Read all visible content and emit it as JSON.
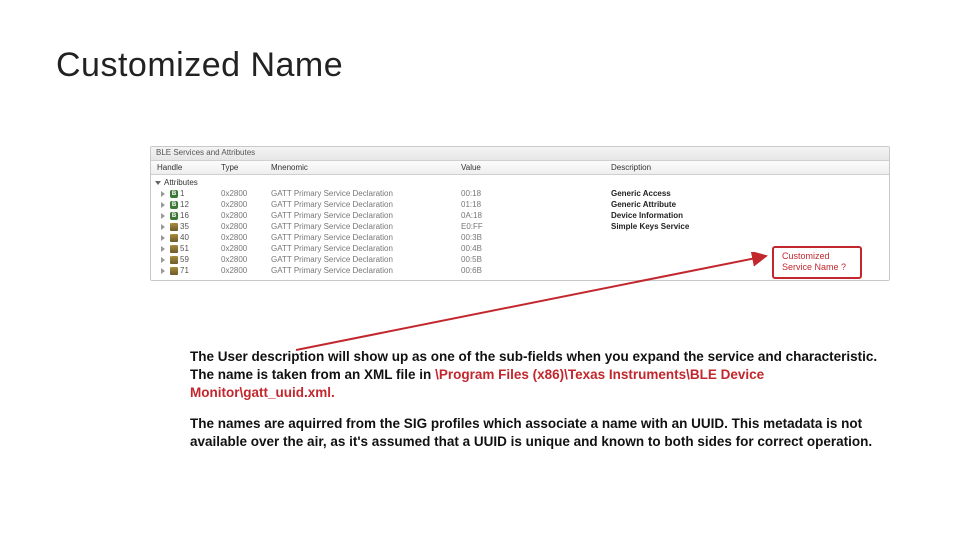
{
  "slide": {
    "title": "Customized Name"
  },
  "panel": {
    "title": "BLE Services and Attributes",
    "columns": {
      "handle": "Handle",
      "type": "Type",
      "mnem": "Mnenomic",
      "value": "Value",
      "desc": "Description"
    },
    "root_label": "Attributes",
    "rows": [
      {
        "icon": "b",
        "handle": "1",
        "type": "0x2800",
        "mnem": "GATT Primary Service Declaration",
        "value": "00:18",
        "desc": "Generic Access"
      },
      {
        "icon": "b",
        "handle": "12",
        "type": "0x2800",
        "mnem": "GATT Primary Service Declaration",
        "value": "01:18",
        "desc": "Generic Attribute"
      },
      {
        "icon": "b",
        "handle": "16",
        "type": "0x2800",
        "mnem": "GATT Primary Service Declaration",
        "value": "0A:18",
        "desc": "Device Information"
      },
      {
        "icon": "chip",
        "handle": "35",
        "type": "0x2800",
        "mnem": "GATT Primary Service Declaration",
        "value": "E0:FF",
        "desc": "Simple Keys Service"
      },
      {
        "icon": "chip",
        "handle": "40",
        "type": "0x2800",
        "mnem": "GATT Primary Service Declaration",
        "value": "00:3B",
        "desc": ""
      },
      {
        "icon": "chip",
        "handle": "51",
        "type": "0x2800",
        "mnem": "GATT Primary Service Declaration",
        "value": "00:4B",
        "desc": ""
      },
      {
        "icon": "chip",
        "handle": "59",
        "type": "0x2800",
        "mnem": "GATT Primary Service Declaration",
        "value": "00:5B",
        "desc": ""
      },
      {
        "icon": "chip",
        "handle": "71",
        "type": "0x2800",
        "mnem": "GATT Primary Service Declaration",
        "value": "00:6B",
        "desc": ""
      }
    ]
  },
  "callout": {
    "line1": "Customized",
    "line2": "Service Name ?"
  },
  "body": {
    "p1_part1": "The User description will show up as one of the sub-fields when you expand the service and characteristic. The name is taken from an XML file in ",
    "p1_path": "\\Program Files (x86)\\Texas Instruments\\BLE Device Monitor\\gatt_uuid.xml.",
    "p2": "The names are aquirred from the SIG profiles which associate a name with an UUID. This metadata is not available over the air, as it's assumed that a UUID is unique and known to both sides for correct operation."
  }
}
